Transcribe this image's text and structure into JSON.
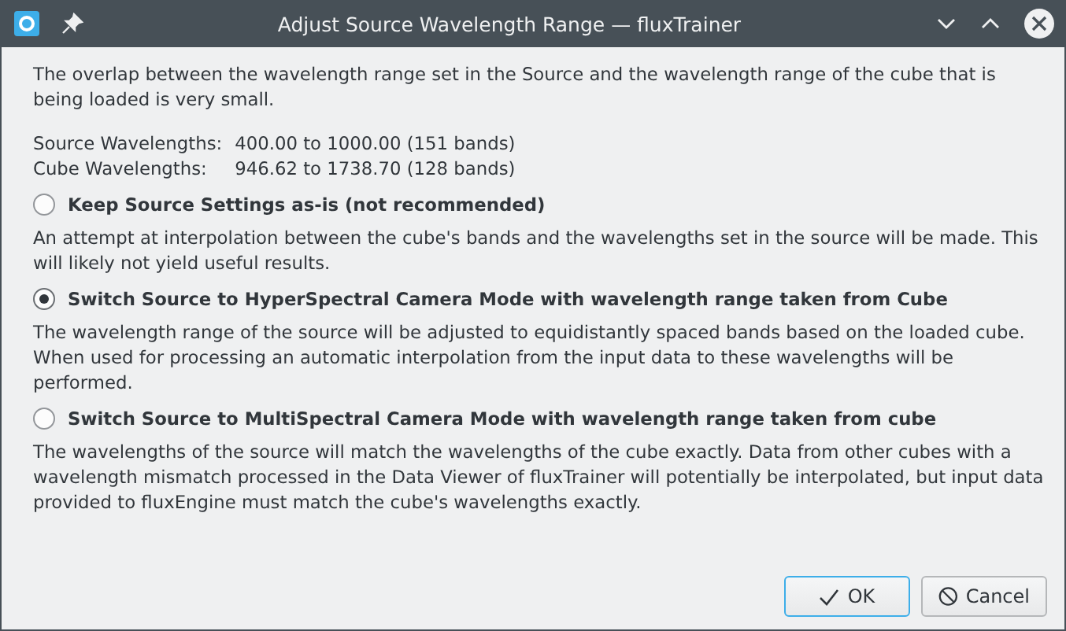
{
  "window": {
    "title": "Adjust Source Wavelength Range — fluxTrainer"
  },
  "intro": "The overlap between the wavelength range set in the Source and the wavelength range of the cube that is being loaded is very small.",
  "wavelengths": [
    {
      "label": "Source Wavelengths:",
      "value": "400.00 to 1000.00 (151 bands)"
    },
    {
      "label": "Cube Wavelengths:",
      "value": "946.62 to 1738.70 (128 bands)"
    }
  ],
  "options": [
    {
      "label": "Keep Source Settings as-is (not recommended)",
      "selected": false,
      "description": "An attempt at interpolation between the cube's bands and the wavelengths set in the source will be made. This will likely not yield useful results."
    },
    {
      "label": "Switch Source to HyperSpectral Camera Mode with wavelength range taken from Cube",
      "selected": true,
      "description": "The wavelength range of the source will be adjusted to equidistantly spaced bands based on the loaded cube. When used for processing an automatic interpolation from the input data to these wavelengths will be performed."
    },
    {
      "label": "Switch Source to MultiSpectral Camera Mode with wavelength range taken from cube",
      "selected": false,
      "description": "The wavelengths of the source will match the wavelengths of the cube exactly. Data from other cubes with a wavelength mismatch processed in the Data Viewer of fluxTrainer will potentially be interpolated, but input data provided to fluxEngine must match the cube's wavelengths exactly."
    }
  ],
  "buttons": [
    {
      "label": "OK",
      "kind": "ok"
    },
    {
      "label": "Cancel",
      "kind": "cancel"
    }
  ]
}
